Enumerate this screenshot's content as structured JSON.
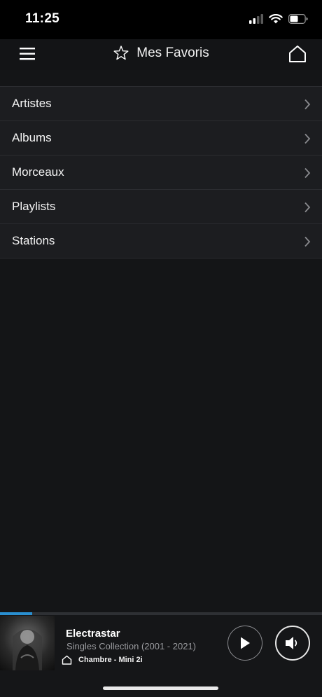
{
  "status_bar": {
    "time": "11:25",
    "icons": [
      "cellular-signal-icon",
      "wifi-icon",
      "battery-icon"
    ]
  },
  "header": {
    "title": "Mes Favoris",
    "icons": [
      "menu-icon",
      "star-icon",
      "home-icon"
    ]
  },
  "favorites_list": {
    "items": [
      {
        "label": "Artistes"
      },
      {
        "label": "Albums"
      },
      {
        "label": "Morceaux"
      },
      {
        "label": "Playlists"
      },
      {
        "label": "Stations"
      }
    ]
  },
  "now_playing": {
    "title": "Electrastar",
    "album": "Singles Collection (2001 - 2021)",
    "room": "Chambre - Mini 2i",
    "progress_fraction": 0.1,
    "icons": [
      "album-art",
      "home-small-icon",
      "play-icon",
      "volume-icon"
    ]
  },
  "colors": {
    "background": "#141517",
    "list_background": "#1c1d20",
    "accent": "#2a8fd0"
  }
}
